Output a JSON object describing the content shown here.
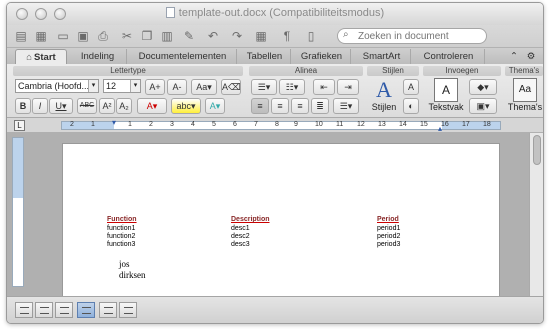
{
  "window": {
    "title": "template-out.docx (Compatibiliteitsmodus)"
  },
  "search": {
    "placeholder": "Zoeken in document"
  },
  "tabs": [
    {
      "label": "Start",
      "active": true
    },
    {
      "label": "Indeling"
    },
    {
      "label": "Documentelementen"
    },
    {
      "label": "Tabellen"
    },
    {
      "label": "Grafieken"
    },
    {
      "label": "SmartArt"
    },
    {
      "label": "Controleren"
    }
  ],
  "groups": {
    "font": "Lettertype",
    "paragraph": "Alinea",
    "styles": "Stijlen",
    "insert": "Invoegen",
    "themes": "Thema's"
  },
  "font": {
    "name": "Cambria (Hoofd...",
    "size": "12"
  },
  "buttons": {
    "styles": "Stijlen",
    "textbox": "Tekstvak",
    "themes": "Thema's"
  },
  "ruler_numbers": [
    "2",
    "1",
    "1",
    "2",
    "3",
    "4",
    "5",
    "6",
    "7",
    "8",
    "9",
    "10",
    "11",
    "12",
    "13",
    "14",
    "15",
    "16",
    "17",
    "18"
  ],
  "document": {
    "headers": [
      "Function",
      "Description",
      "Period"
    ],
    "rows": [
      [
        "function1",
        "desc1",
        "period1"
      ],
      [
        "function2",
        "desc2",
        "period2"
      ],
      [
        "function3",
        "desc3",
        "period3"
      ]
    ],
    "lines": [
      "jos",
      "dirksen"
    ]
  },
  "colors": {
    "accent": "#4a7fc1",
    "header_text": "#8a2a2a"
  }
}
